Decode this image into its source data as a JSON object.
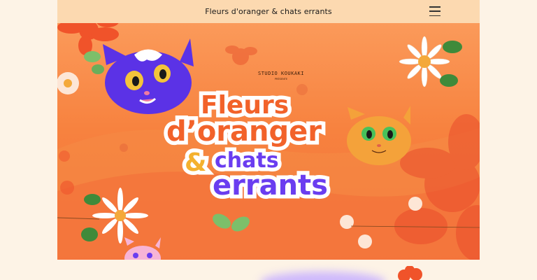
{
  "header": {
    "title": "Fleurs d'oranger & chats errants",
    "menu_icon": "hamburger-menu-icon"
  },
  "hero": {
    "studio_name": "STUDIO KOUKAKI",
    "studio_sub": "PRÉSENTE",
    "title_line1": "Fleurs",
    "title_line2": "d’oranger",
    "title_amp": "&",
    "title_line3": "chats",
    "title_line4": "errants"
  },
  "colors": {
    "header_bg": "#fcd9b0",
    "page_bg": "#fdf3e6",
    "title_orange": "#f2622a",
    "title_purple": "#6a3df0",
    "amp_yellow": "#f4b12e"
  }
}
